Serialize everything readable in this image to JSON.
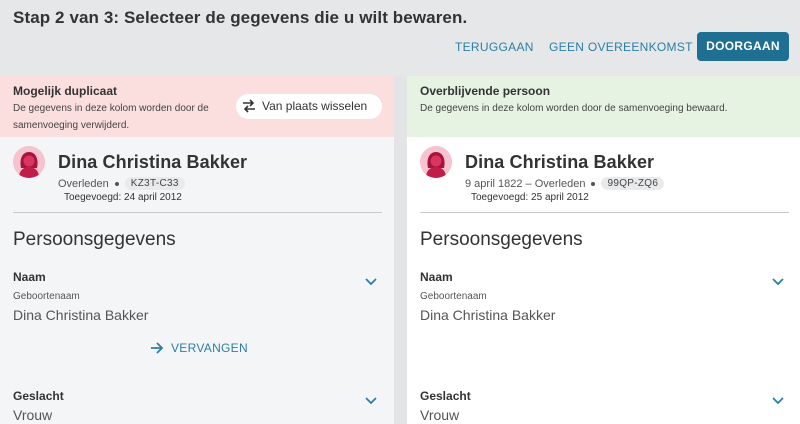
{
  "header": {
    "step_title": "Stap 2 van 3: Selecteer de gegevens die u wilt bewaren.",
    "back_label": "TERUGGAAN",
    "no_match_label": "GEEN OVEREENKOMST",
    "continue_label": "DOORGAAN"
  },
  "left": {
    "title": "Mogelijk duplicaat",
    "description": "De gegevens in deze kolom worden door de samenvoeging verwijderd.",
    "swap_label": "Van plaats wisselen",
    "person": {
      "name": "Dina Christina Bakker",
      "life": "Overleden",
      "pid": "KZ3T-C33",
      "added": "Toegevoegd: 24 april 2012"
    },
    "section_title": "Persoonsgegevens",
    "name_field": {
      "label": "Naam",
      "sub": "Geboortenaam",
      "value": "Dina Christina Bakker"
    },
    "replace_label": "VERVANGEN",
    "gender_field": {
      "label": "Geslacht",
      "value": "Vrouw"
    }
  },
  "right": {
    "title": "Overblijvende persoon",
    "description": "De gegevens in deze kolom worden door de samenvoeging bewaard.",
    "person": {
      "name": "Dina Christina Bakker",
      "life": "9 april 1822 – Overleden",
      "pid": "99QP-ZQ6",
      "added": "Toegevoegd: 25 april 2012"
    },
    "section_title": "Persoonsgegevens",
    "name_field": {
      "label": "Naam",
      "sub": "Geboortenaam",
      "value": "Dina Christina Bakker"
    },
    "gender_field": {
      "label": "Geslacht",
      "value": "Vrouw"
    }
  },
  "colors": {
    "accent": "#2b7fa4",
    "primary_button": "#1f6f93",
    "duplicate_header": "#fbdede",
    "survivor_header": "#e6f3e3"
  }
}
